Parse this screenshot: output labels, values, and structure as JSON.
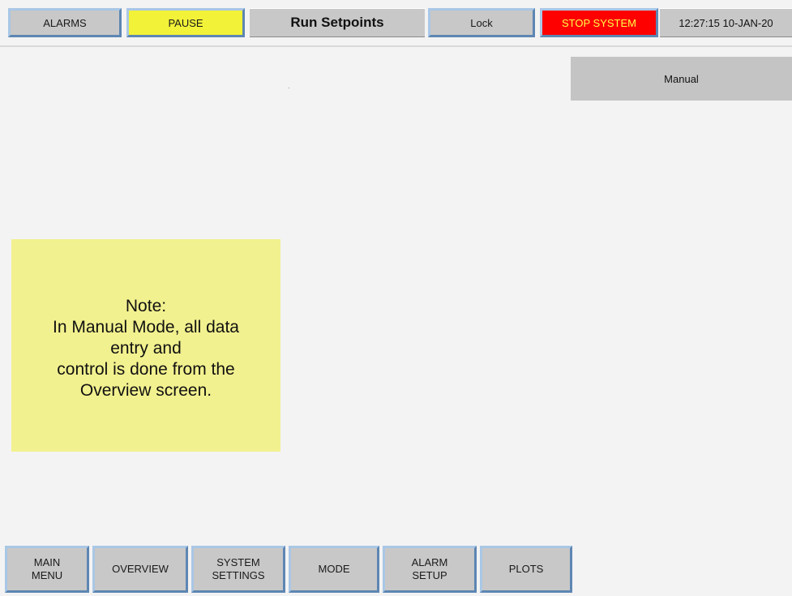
{
  "topbar": {
    "alarms_label": "ALARMS",
    "pause_label": "PAUSE",
    "title": "Run Setpoints",
    "lock_label": "Lock",
    "stop_label": "STOP SYSTEM",
    "clock": "12:27:15 10-JAN-20"
  },
  "mode": {
    "label": "Manual"
  },
  "note": {
    "lines": [
      "Note:",
      "In Manual Mode, all data",
      "entry and",
      "control is done from the",
      "Overview screen."
    ]
  },
  "nav": {
    "main_menu": [
      "MAIN",
      "MENU"
    ],
    "overview": "OVERVIEW",
    "system_settings": [
      "SYSTEM",
      "SETTINGS"
    ],
    "mode": "MODE",
    "alarm_setup": [
      "ALARM",
      "SETUP"
    ],
    "plots": "PLOTS"
  },
  "colors": {
    "background": "#f3f3f3",
    "button_gray": "#c8c8c8",
    "button_border": "#8fb3d6",
    "pause_yellow": "#f2f238",
    "stop_red": "#ff0000",
    "stop_text": "#ffff4a",
    "note_yellow": "#f2f18f"
  }
}
